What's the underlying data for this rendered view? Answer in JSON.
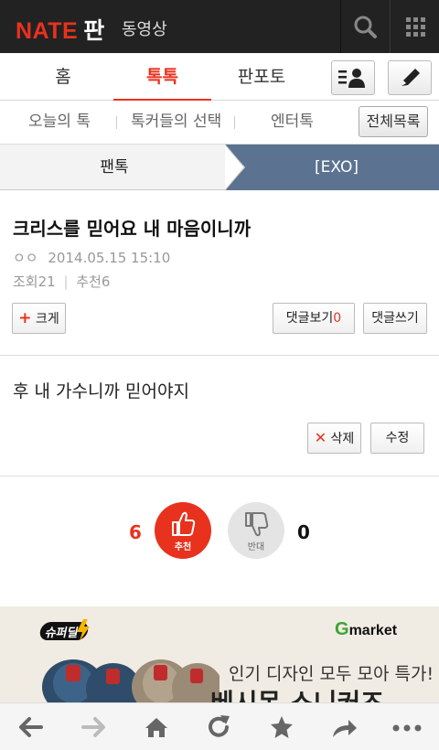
{
  "header": {
    "logo_nate": "NATE",
    "logo_pan": "판",
    "video_link": "동영상",
    "search_icon": "search-icon",
    "apps_icon": "grid-icon"
  },
  "main_tabs": [
    {
      "label": "홈",
      "active": false
    },
    {
      "label": "톡톡",
      "active": true
    },
    {
      "label": "판포토",
      "active": false
    }
  ],
  "sub_tabs": {
    "items": [
      "오늘의 톡",
      "톡커들의 선택",
      "엔터톡"
    ],
    "all_list": "전체목록"
  },
  "breadcrumb": {
    "left": "팬톡",
    "right": "[EXO]"
  },
  "post": {
    "title": "크리스를 믿어요 내 마음이니까",
    "author": "ㅇㅇ",
    "datetime": "2014.05.15 15:10",
    "views_label": "조회21",
    "recommend_label": "추천6",
    "enlarge_label": "크게",
    "view_comments_label": "댓글보기",
    "comment_count": "0",
    "write_comment_label": "댓글쓰기",
    "body": "후 내 가수니까 믿어야지",
    "delete_label": "삭제",
    "edit_label": "수정"
  },
  "votes": {
    "up_count": "6",
    "up_label": "추천",
    "down_count": "0",
    "down_label": "반대"
  },
  "ad": {
    "badge": "슈퍼딜",
    "brand": "market",
    "brand_g": "G",
    "copy": "인기 디자인 모두 모아 특가!",
    "headline": "베시몬 스니커즈"
  },
  "colors": {
    "accent": "#e8321e",
    "breadcrumb_active": "#5b7390",
    "topbar": "#222222"
  }
}
